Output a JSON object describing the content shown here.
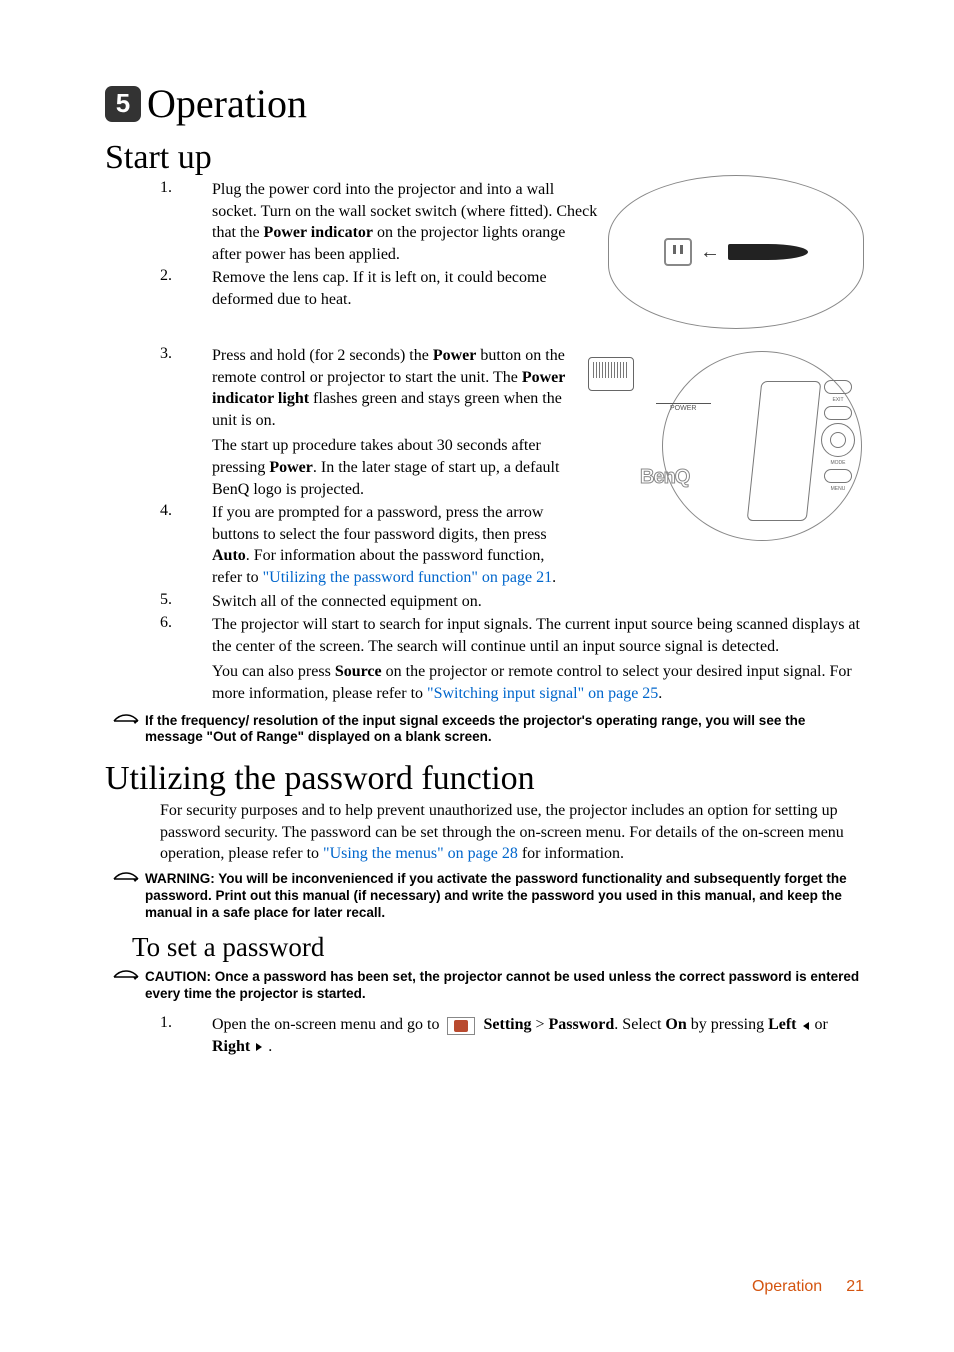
{
  "chapter": {
    "number": "5",
    "title": "Operation"
  },
  "section_startup": {
    "heading": "Start up"
  },
  "steps": {
    "s1": {
      "num": "1.",
      "p1a": "Plug the power cord into the projector and into a wall socket. Turn on the wall socket switch (where fitted). Check that the ",
      "p1b": "Power indicator",
      "p1c": " on the projector lights orange after power has been applied."
    },
    "s2": {
      "num": "2.",
      "text": "Remove the lens cap. If it is left on, it could become deformed due to heat."
    },
    "s3": {
      "num": "3.",
      "p1a": "Press and hold (for 2 seconds) the ",
      "p1b": "Power",
      "p1c": " button on the remote control or projector to start the unit. The ",
      "p1d": "Power indicator light",
      "p1e": " flashes green and stays green when the unit is on.",
      "p2a": "The start up procedure takes about 30 seconds after pressing ",
      "p2b": "Power",
      "p2c": ". In the later stage of start up, a default BenQ logo is projected."
    },
    "s4": {
      "num": "4.",
      "p1a": "If you are prompted for a password, press the arrow buttons to select the four password digits, then press ",
      "p1b": "Auto",
      "p1c": ". For information about the password function, refer to ",
      "link": "\"Utilizing the password function\" on page 21",
      "p1d": "."
    },
    "s5": {
      "num": "5.",
      "text": "Switch all of the connected equipment on."
    },
    "s6": {
      "num": "6.",
      "p1": "The projector will start to search for input signals. The current input source being scanned displays at the center of the screen. The search will continue until an input source signal is detected.",
      "p2a": "You can also press ",
      "p2b": "Source",
      "p2c": " on the projector or remote control to select your desired input signal. For more information, please refer to ",
      "link": "\"Switching input signal\" on page 25",
      "p2d": "."
    }
  },
  "note_range": "If the frequency/ resolution of the input signal exceeds the projector's operating range, you will see the message \"Out of Range\" displayed on a blank screen.",
  "section_password": {
    "heading": "Utilizing the password function"
  },
  "password_intro_a": "For security purposes and to help prevent unauthorized use, the projector includes an option for setting up password security. The password can be set through the on-screen menu. For details of the on-screen menu operation, please refer to ",
  "password_intro_link": "\"Using the menus\" on page 28",
  "password_intro_b": " for information.",
  "note_warning": "WARNING: You will be inconvenienced if you activate the password functionality and subsequently forget the password. Print out this manual (if necessary) and write the password you used in this manual, and keep the manual in a safe place for later recall.",
  "subsection_setpw": {
    "heading": "To set a password"
  },
  "note_caution": "CAUTION: Once a password has been set, the projector cannot be used unless the correct password is entered every time the projector is started.",
  "setpw_step1": {
    "num": "1.",
    "a": "Open the on-screen menu and go to ",
    "menu1": "Setting",
    "sep": " > ",
    "menu2": "Password",
    "b": ". Select ",
    "on": "On",
    "c": " by pressing ",
    "left": "Left",
    "or": " or ",
    "right": "Right",
    "d": " ."
  },
  "fig2": {
    "power": "POWER",
    "exit": "EXIT",
    "mode": "MODE",
    "menu": "MENU",
    "benq": "BenQ"
  },
  "footer": {
    "label": "Operation",
    "page": "21"
  }
}
